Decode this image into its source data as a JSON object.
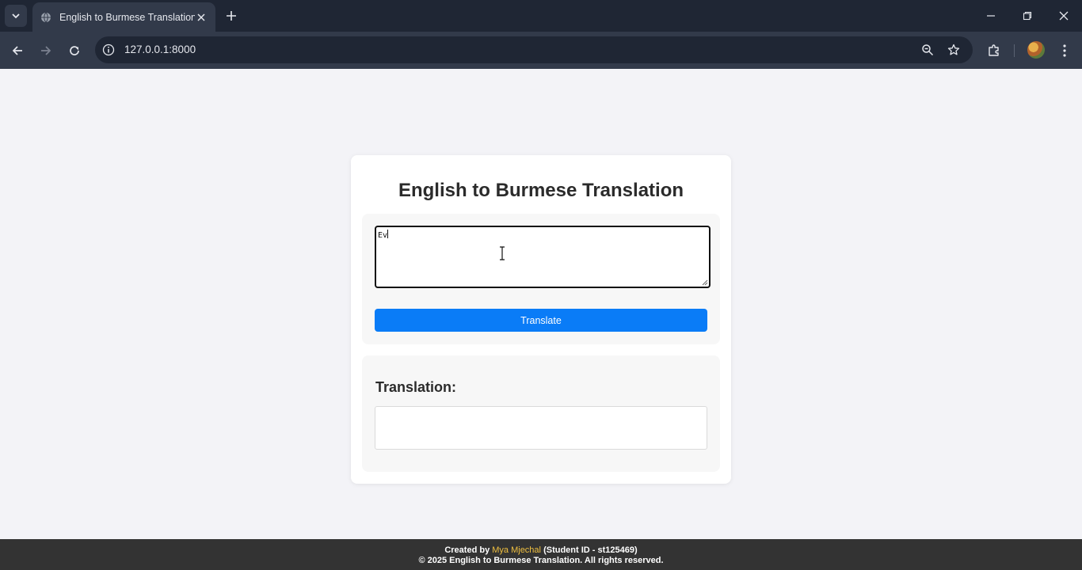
{
  "browser": {
    "tab_title": "English to Burmese Translation",
    "url": "127.0.0.1:8000"
  },
  "page": {
    "title": "English to Burmese Translation",
    "input_value": "Ev",
    "translate_label": "Translate",
    "result_heading": "Translation:",
    "result_value": ""
  },
  "footer": {
    "created_by": "Created by",
    "author": "Mya Mjechal",
    "student_id": "(Student ID - st125469)",
    "copyright": "© 2025 English to Burmese Translation. All rights reserved."
  },
  "colors": {
    "accent": "#0a7cf7",
    "footer_bg": "#333333",
    "author_link": "#f0c040"
  }
}
